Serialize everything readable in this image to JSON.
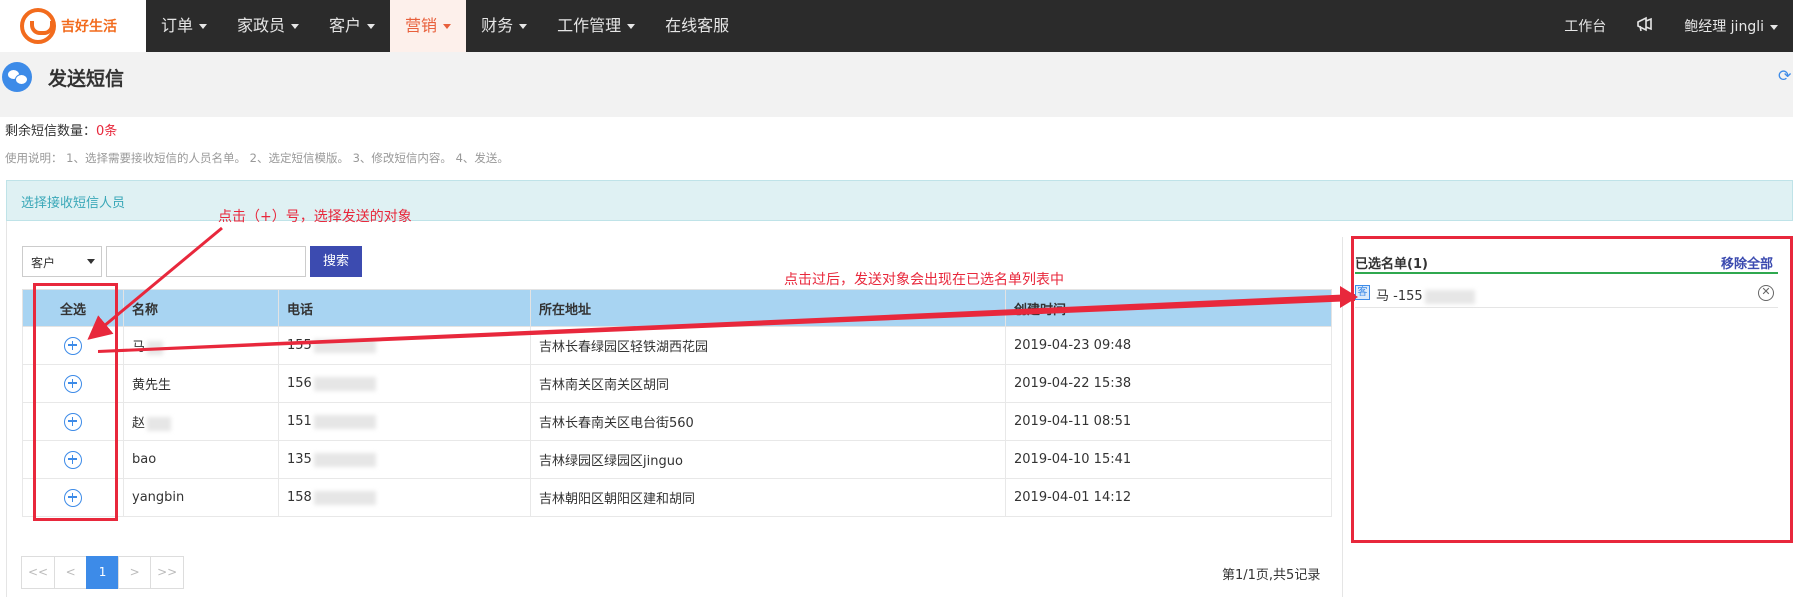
{
  "nav": {
    "logo_text": "吉好生活",
    "menu": [
      {
        "label": "订单",
        "caret": true,
        "active": false
      },
      {
        "label": "家政员",
        "caret": true,
        "active": false
      },
      {
        "label": "客户",
        "caret": true,
        "active": false
      },
      {
        "label": "营销",
        "caret": true,
        "active": true
      },
      {
        "label": "财务",
        "caret": true,
        "active": false
      },
      {
        "label": "工作管理",
        "caret": true,
        "active": false
      },
      {
        "label": "在线客服",
        "caret": false,
        "active": false
      }
    ],
    "workbench": "工作台",
    "user": "鲍经理 jingli"
  },
  "header": {
    "title": "发送短信"
  },
  "sms": {
    "remain_label": "剩余短信数量：",
    "remain_count": "0条",
    "hint": "使用说明： 1、选择需要接收短信的人员名单。 2、选定短信模版。 3、修改短信内容。 4、发送。"
  },
  "panel": {
    "title": "选择接收短信人员"
  },
  "search": {
    "type_value": "客户",
    "keyword_value": "",
    "button": "搜索"
  },
  "table": {
    "headers": [
      "全选",
      "名称",
      "电话",
      "所在地址",
      "创建时间"
    ],
    "rows": [
      {
        "name": "马",
        "phone": "155",
        "address": "吉林长春绿园区轻铁湖西花园",
        "created": "2019-04-23 09:48"
      },
      {
        "name": "黄先生",
        "phone": "156",
        "address": "吉林南关区南关区胡同",
        "created": "2019-04-22 15:38"
      },
      {
        "name": "赵",
        "phone": "151",
        "address": "吉林长春南关区电台街560",
        "created": "2019-04-11 08:51"
      },
      {
        "name": "bao",
        "phone": "135",
        "address": "吉林绿园区绿园区jinguo",
        "created": "2019-04-10 15:41"
      },
      {
        "name": "yangbin",
        "phone": "158",
        "address": "吉林朝阳区朝阳区建和胡同",
        "created": "2019-04-01 14:12"
      }
    ]
  },
  "pager": {
    "first": "<<",
    "prev": "<",
    "current": "1",
    "next": ">",
    "last": ">>",
    "info": "第1/1页,共5记录"
  },
  "selected": {
    "title": "已选名单(1)",
    "remove_all": "移除全部",
    "items": [
      {
        "tag": "客",
        "text": "马  -155"
      }
    ]
  },
  "annotations": {
    "click_plus": "点击（+）号，选择发送的对象",
    "after_click": "点击过后，发送对象会出现在已选名单列表中"
  },
  "colors": {
    "accent": "#e8603c",
    "nav_bg": "#2b2b2b",
    "primary": "#3d8be8",
    "annotation": "#e8283c"
  }
}
